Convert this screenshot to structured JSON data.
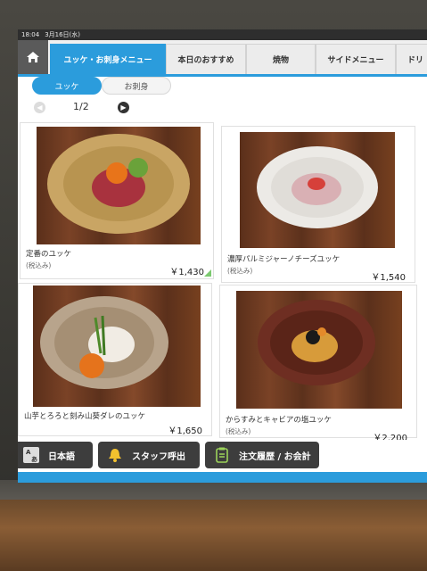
{
  "status": {
    "time": "18:04",
    "date": "3月16日(水)"
  },
  "tabs": [
    {
      "label": "ユッケ・お刺身メニュー",
      "active": true
    },
    {
      "label": "本日のおすすめ",
      "active": false
    },
    {
      "label": "焼物",
      "active": false
    },
    {
      "label": "サイドメニュー",
      "active": false
    },
    {
      "label": "ドリ",
      "active": false
    }
  ],
  "subtabs": [
    {
      "label": "ユッケ",
      "active": true
    },
    {
      "label": "お刺身",
      "active": false
    }
  ],
  "pager": {
    "page": "1/2"
  },
  "items": [
    {
      "name": "定番のユッケ",
      "tax": "(税込み)",
      "price": "￥1,430"
    },
    {
      "name": "濃厚パルミジャーノチーズユッケ",
      "tax": "(税込み)",
      "price": "￥1,540"
    },
    {
      "name": "山芋とろろと刻み山葵ダレのユッケ",
      "tax": "(税込み)",
      "price": "￥1,650"
    },
    {
      "name": "からすみとキャビアの塩ユッケ",
      "tax": "(税込み)",
      "price": "￥2,200"
    }
  ],
  "bottom": {
    "language": "日本語",
    "staff_call": "スタッフ呼出",
    "history": "注文履歴 / お会計"
  },
  "colors": {
    "accent": "#2b9cdc",
    "button": "#3d3d3d"
  }
}
